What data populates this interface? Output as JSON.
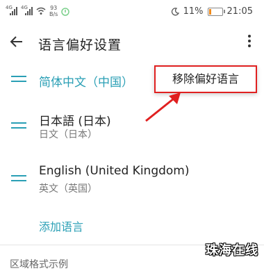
{
  "status_bar": {
    "signal1_tag": "4G",
    "signal2_tag": "4G",
    "net_speed_value": "93",
    "net_speed_unit": "B/s",
    "battery_percent": "11%",
    "time": "21:05",
    "battery_color": "#f08a1a"
  },
  "appbar": {
    "title": "语言偏好设置",
    "back_icon": "arrow-left-icon",
    "more_icon": "more-vertical-icon"
  },
  "languages": [
    {
      "name": "简体中文（中国）",
      "sub": "",
      "selected": true
    },
    {
      "name": "日本語 (日本)",
      "sub": "日文（日本）",
      "selected": false
    },
    {
      "name": "English (United Kingdom)",
      "sub": "英文（英国）",
      "selected": false
    }
  ],
  "add_language_label": "添加语言",
  "popup_label": "移除偏好语言",
  "section_header": "区域格式示例",
  "watermark": "珠海在线",
  "colors": {
    "accent": "#2a9fb5",
    "highlight": "#e02020"
  }
}
